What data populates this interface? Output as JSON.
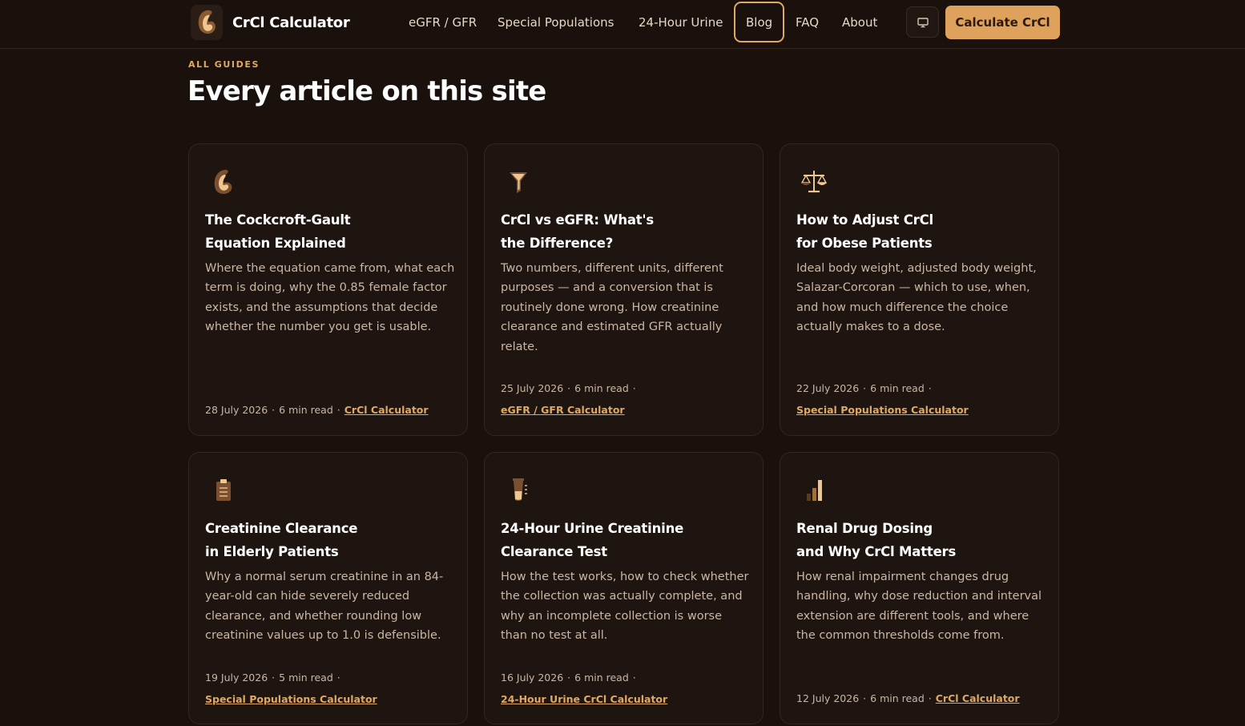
{
  "header": {
    "brand": "CrCl Calculator",
    "nav": [
      {
        "label": "eGFR / GFR",
        "active": false
      },
      {
        "label": "Special Populations",
        "active": false
      },
      {
        "label": "24-Hour Urine",
        "active": false
      },
      {
        "label": "Blog",
        "active": true
      },
      {
        "label": "FAQ",
        "active": false
      },
      {
        "label": "About",
        "active": false
      }
    ],
    "theme_icon": "monitor-icon",
    "cta_label": "Calculate CrCl"
  },
  "page": {
    "eyebrow": "ALL GUIDES",
    "title": "Every article on this site"
  },
  "colors": {
    "background": "#1a110d",
    "card": "#1f1510",
    "accent": "#e1a862",
    "cta": "#dfa25c"
  },
  "articles": [
    {
      "icon": "kidney-icon",
      "title_line1": "The Cockcroft-Gault",
      "title_line2": "Equation Explained",
      "description": "Where the equation came from, what each term is doing, why the 0.85 female factor exists, and the assumptions that decide whether the number you get is usable.",
      "date": "28 July 2026",
      "read_time": "6 min read",
      "link": "CrCl Calculator"
    },
    {
      "icon": "funnel-icon",
      "title_line1": "CrCl vs eGFR: What's",
      "title_line2": "the Difference?",
      "description": "Two numbers, different units, different purposes — and a conversion that is routinely done wrong. How creatinine clearance and estimated GFR actually relate.",
      "date": "25 July 2026",
      "read_time": "6 min read",
      "link": "eGFR / GFR Calculator"
    },
    {
      "icon": "scale-icon",
      "title_line1": "How to Adjust CrCl",
      "title_line2": "for Obese Patients",
      "description": "Ideal body weight, adjusted body weight, Salazar-Corcoran — which to use, when, and how much difference the choice actually makes to a dose.",
      "date": "22 July 2026",
      "read_time": "6 min read",
      "link": "Special Populations Calculator"
    },
    {
      "icon": "clipboard-icon",
      "title_line1": "Creatinine Clearance",
      "title_line2": "in Elderly Patients",
      "description": "Why a normal serum creatinine in an 84-year-old can hide severely reduced clearance, and whether rounding low creatinine values up to 1.0 is defensible.",
      "date": "19 July 2026",
      "read_time": "5 min read",
      "link": "Special Populations Calculator"
    },
    {
      "icon": "urine-container-icon",
      "title_line1": "24-Hour Urine Creatinine",
      "title_line2": "Clearance Test",
      "description": "How the test works, how to check whether the collection was actually complete, and why an incomplete collection is worse than no test at all.",
      "date": "16 July 2026",
      "read_time": "6 min read",
      "link": "24-Hour Urine CrCl Calculator"
    },
    {
      "icon": "bar-chart-icon",
      "title_line1": "Renal Drug Dosing",
      "title_line2": "and Why CrCl Matters",
      "description": "How renal impairment changes drug handling, why dose reduction and interval extension are different tools, and where the common thresholds come from.",
      "date": "12 July 2026",
      "read_time": "6 min read",
      "link": "CrCl Calculator"
    }
  ]
}
